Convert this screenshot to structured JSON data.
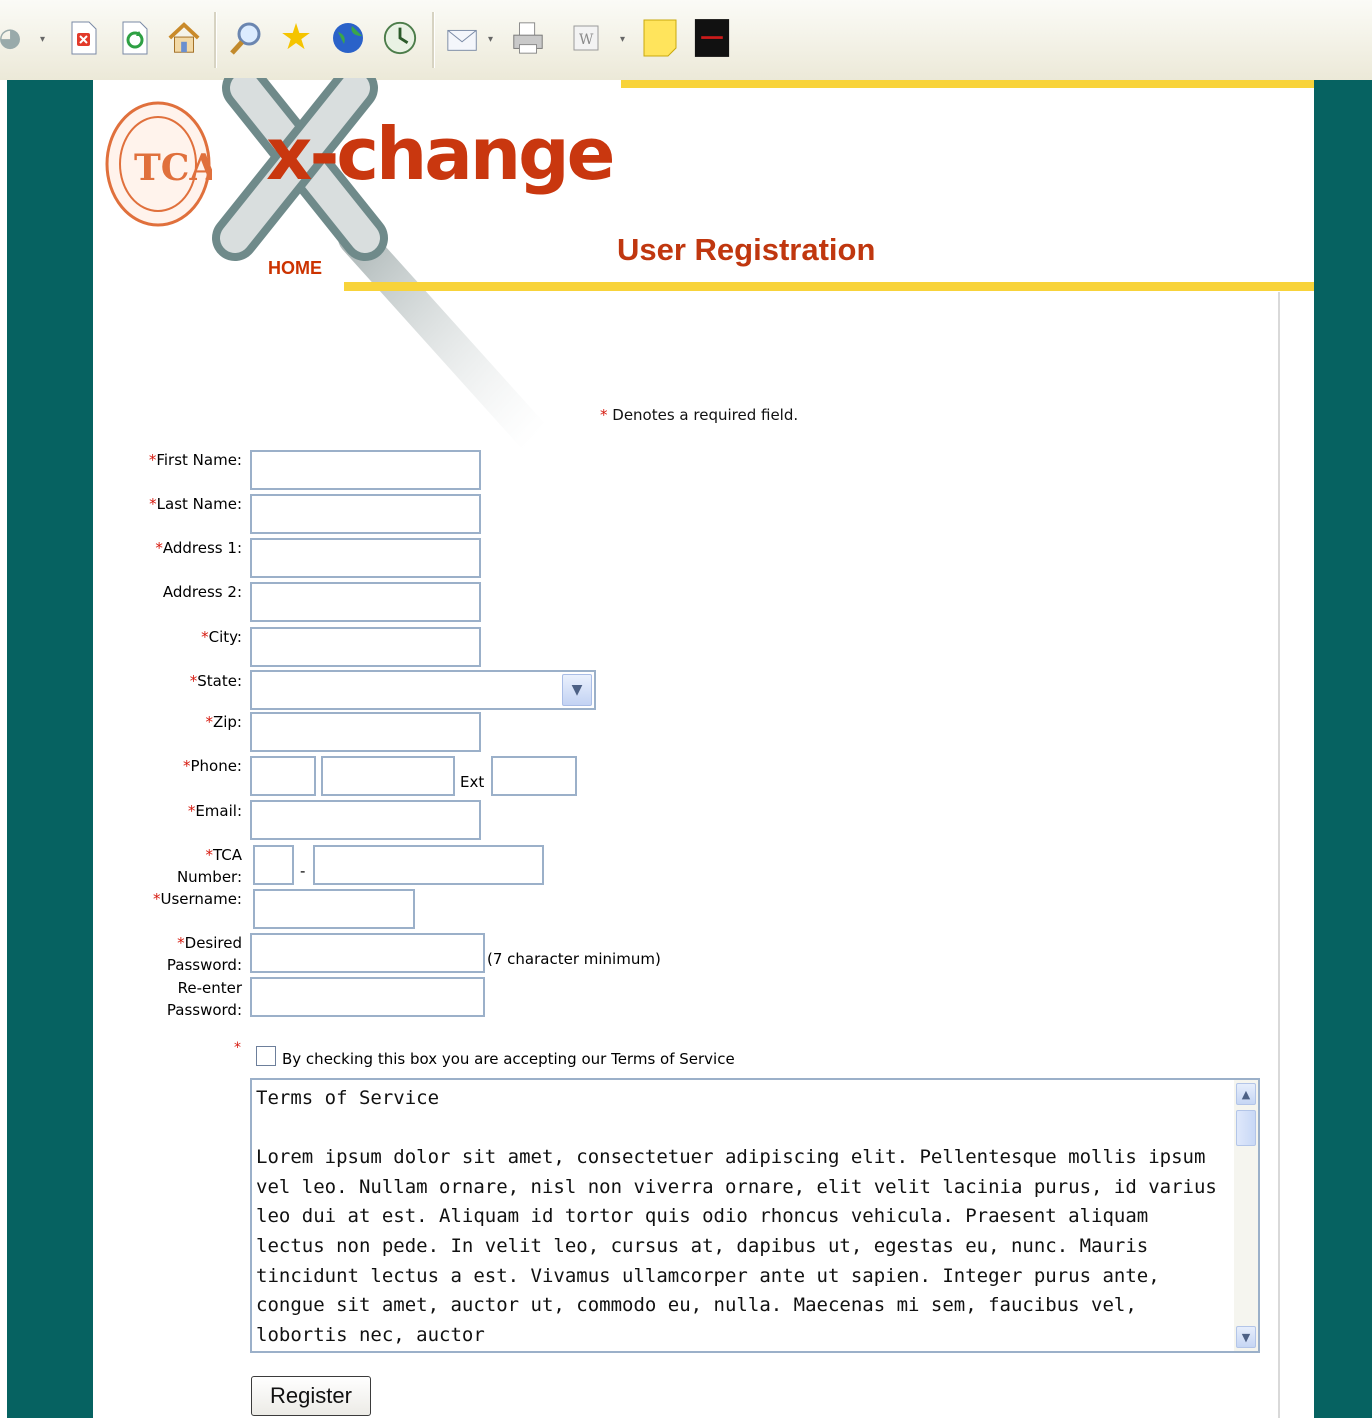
{
  "toolbar": {
    "icons": [
      "back-arrow-icon",
      "stop-icon",
      "refresh-icon",
      "home-icon",
      "search-icon",
      "favorites-star-icon",
      "globe-icon",
      "history-icon",
      "mail-icon",
      "print-icon",
      "word-icon",
      "sticky-note-icon",
      "app-icon"
    ]
  },
  "header": {
    "logo_text": "x-change",
    "home_link": "HOME",
    "page_title": "User Registration"
  },
  "colors": {
    "teal_frame": "#066261",
    "accent_yellow": "#f8d33a",
    "brand_orange": "#c0370f",
    "required_red": "#d61a0f"
  },
  "form": {
    "required_note_star": "*",
    "required_note": " Denotes a required field.",
    "required_mark": "*",
    "fields": {
      "first_name": "First Name:",
      "last_name": "Last Name:",
      "address1": "Address 1:",
      "address2": "Address 2:",
      "city": "City:",
      "state": "State:",
      "zip": "Zip:",
      "phone": "Phone:",
      "email": "Email:",
      "tca_line1": "TCA",
      "tca_line2": "Number:",
      "username": "Username:",
      "desired_line1": "Desired",
      "desired_line2": "Password:",
      "reenter_line1": "Re-enter",
      "reenter_line2": "Password:"
    },
    "state_selected": "",
    "ext_label": "Ext",
    "tca_dash": "-",
    "password_hint": "(7 character minimum)",
    "tos_check_label": "By checking this box you are accepting our Terms of Service",
    "tos_title": "Terms of Service",
    "tos_body": "Lorem ipsum dolor sit amet, consectetuer adipiscing elit. Pellentesque mollis ipsum vel leo. Nullam ornare, nisl non viverra ornare, elit velit lacinia purus, id varius leo dui at est. Aliquam id tortor quis odio rhoncus vehicula. Praesent aliquam lectus non pede. In velit leo, cursus at, dapibus ut, egestas eu, nunc. Mauris tincidunt lectus a est. Vivamus ullamcorper ante ut sapien. Integer purus ante, congue sit amet, auctor ut, commodo eu, nulla. Maecenas mi sem, faucibus vel, lobortis nec, auctor",
    "register_label": "Register"
  }
}
